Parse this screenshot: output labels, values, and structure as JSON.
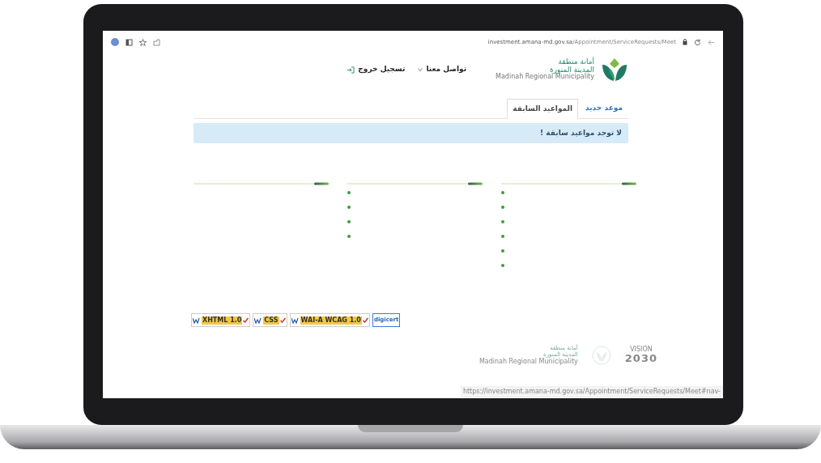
{
  "browser": {
    "domain": "investment.amana-md.gov.sa",
    "path": "/Appointment/ServiceRequests/Meet"
  },
  "header": {
    "logo": {
      "line_1": "أمانة منطقة",
      "line_2": "المدينة المنورة",
      "line_3": "Madinah Regional Municipality"
    },
    "nav": [
      {
        "label": "تواصل معنا",
        "kind": "dropdown"
      },
      {
        "label": "تسجيل خروج",
        "kind": "logout"
      }
    ]
  },
  "tabs": [
    {
      "label": "موعد جديد",
      "selected": false
    },
    {
      "label": "المواعيد السابقة",
      "selected": true
    }
  ],
  "alert": "لا توجد مواعيد سابقة !",
  "footer_columns": [
    {
      "kind": "list",
      "items": [
        {
          "kind": "bullet"
        },
        {
          "kind": "bullet"
        },
        {
          "kind": "bullet"
        },
        {
          "kind": "bullet"
        },
        {
          "kind": "bullet"
        },
        {
          "kind": "bullet"
        }
      ]
    },
    {
      "kind": "list",
      "items": [
        {
          "kind": "bullet"
        },
        {
          "kind": "bullet"
        },
        {
          "kind": "bullet"
        },
        {
          "kind": "bullet"
        }
      ]
    },
    {
      "kind": "empty"
    }
  ],
  "badges": [
    {
      "kind": "digicert",
      "label": "digicert"
    },
    {
      "kind": "w3c",
      "label": "WAI-A WCAG 1.0"
    },
    {
      "kind": "w3c",
      "label": "CSS"
    },
    {
      "kind": "w3c",
      "label": "XHTML 1.0"
    }
  ],
  "footer_logos": {
    "vision": {
      "line_1": "VISION",
      "line_2": "2030"
    },
    "municipality": {
      "line_1": "أمانة منطقة",
      "line_2": "المدينة المنورة",
      "line_3": "Madinah Regional Municipality"
    }
  },
  "status_bar": "https://investment.amana-md.gov.sa/Appointment/ServiceRequests/Meet#nav-"
}
